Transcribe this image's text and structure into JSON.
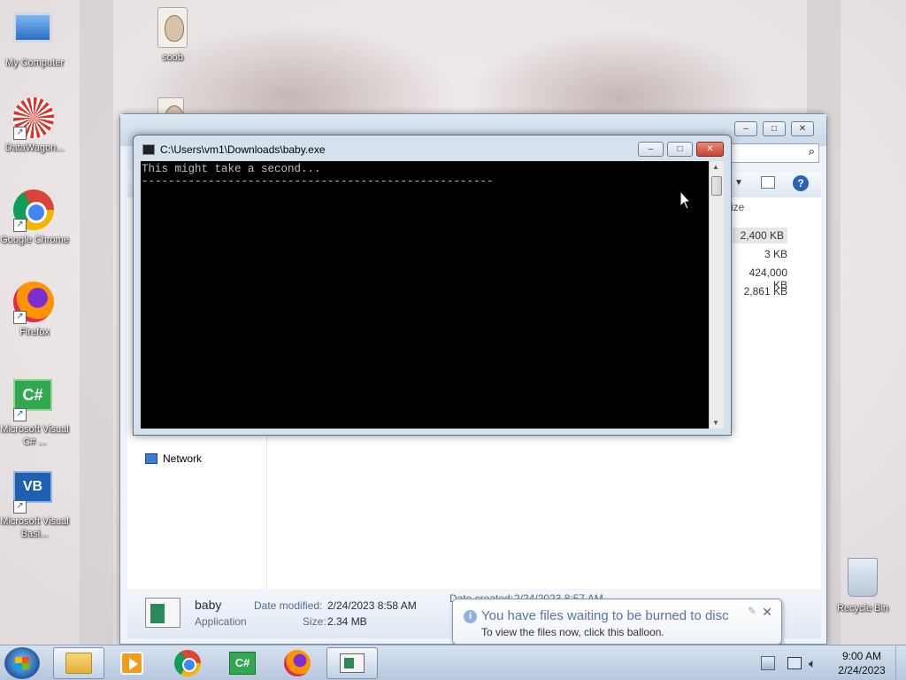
{
  "desktop": {
    "icons": [
      {
        "label": "My Computer"
      },
      {
        "label": "DataWagon..."
      },
      {
        "label": "Google Chrome"
      },
      {
        "label": "Firefox"
      },
      {
        "label": "Microsoft Visual C# ..."
      },
      {
        "label": "Microsoft Visual Basi..."
      },
      {
        "label": "soob"
      },
      {
        "label": "Recycle Bin"
      }
    ]
  },
  "explorer": {
    "column_header": "ize",
    "sizes": [
      "2,400 KB",
      "3 KB",
      "424,000 KB",
      "2,861 KB"
    ],
    "nav_network": "Network",
    "details": {
      "name": "baby",
      "type": "Application",
      "date_modified_label": "Date modified:",
      "date_modified": "2/24/2023 8:58 AM",
      "size_label": "Size:",
      "size": "2.34 MB",
      "date_created_label": "Date created:",
      "date_created": "2/24/2023 8:57 AM"
    },
    "buttons": {
      "minimize": "–",
      "maximize": "□",
      "close": "✕"
    }
  },
  "console": {
    "title": "C:\\Users\\vm1\\Downloads\\baby.exe",
    "output": "This might take a second...\n-----------------------------------------------------",
    "buttons": {
      "minimize": "–",
      "maximize": "□",
      "close": "✕"
    }
  },
  "balloon": {
    "title": "You have files waiting to be burned to disc",
    "text": "To view the files now, click this balloon.",
    "close": "✕"
  },
  "taskbar": {
    "time": "9:00 AM",
    "date": "2/24/2023"
  }
}
